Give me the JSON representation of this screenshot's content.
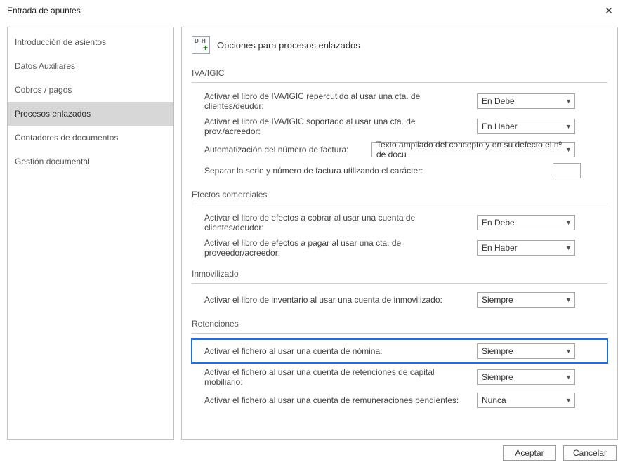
{
  "window": {
    "title": "Entrada de apuntes"
  },
  "sidebar": {
    "items": [
      {
        "label": "Introducción de asientos"
      },
      {
        "label": "Datos Auxiliares"
      },
      {
        "label": "Cobros / pagos"
      },
      {
        "label": "Procesos enlazados",
        "selected": true
      },
      {
        "label": "Contadores de documentos"
      },
      {
        "label": "Gestión documental"
      }
    ]
  },
  "main": {
    "header_title": "Opciones para procesos enlazados",
    "sections": {
      "iva": {
        "title": "IVA/IGIC",
        "rows": {
          "repercutido": {
            "label": "Activar el libro de IVA/IGIC repercutido al usar una cta. de clientes/deudor:",
            "value": "En Debe"
          },
          "soportado": {
            "label": "Activar el libro de IVA/IGIC soportado al usar una cta. de prov./acreedor:",
            "value": "En Haber"
          },
          "automatizacion": {
            "label": "Automatización del número de factura:",
            "value": "Texto ampliado del concepto y en su defecto el nº de docu"
          },
          "separador": {
            "label": "Separar la serie y número de factura utilizando el carácter:",
            "value": ""
          }
        }
      },
      "efectos": {
        "title": "Efectos comerciales",
        "rows": {
          "cobrar": {
            "label": "Activar el libro de efectos a cobrar al usar una cuenta de clientes/deudor:",
            "value": "En Debe"
          },
          "pagar": {
            "label": "Activar el libro de efectos a pagar al usar una cta. de proveedor/acreedor:",
            "value": "En Haber"
          }
        }
      },
      "inmovilizado": {
        "title": "Inmovilizado",
        "rows": {
          "inventario": {
            "label": "Activar el libro de inventario al usar una cuenta de inmovilizado:",
            "value": "Siempre"
          }
        }
      },
      "retenciones": {
        "title": "Retenciones",
        "rows": {
          "nomina": {
            "label": "Activar el fichero al usar una cuenta de nómina:",
            "value": "Siempre"
          },
          "capital": {
            "label": "Activar el fichero al usar una cuenta de retenciones de capital mobiliario:",
            "value": "Siempre"
          },
          "remun": {
            "label": "Activar el fichero al usar una cuenta de remuneraciones pendientes:",
            "value": "Nunca"
          }
        }
      }
    }
  },
  "footer": {
    "accept": "Aceptar",
    "cancel": "Cancelar"
  }
}
